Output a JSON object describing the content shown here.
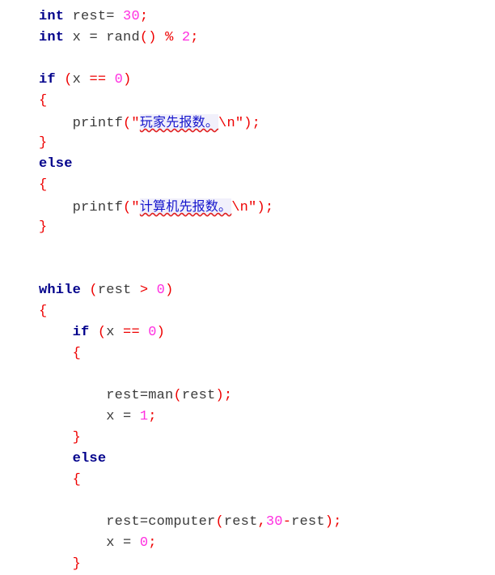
{
  "document": {
    "language": "C",
    "background_color": "#ffffff",
    "colors": {
      "keyword": "#00008b",
      "identifier": "#3b3b3b",
      "punctuation": "#ee0000",
      "number": "#ff2fe0",
      "string_cjk": "#1414cc",
      "string_highlight": "#f1f0fb",
      "spellcheck_underline": "#e02020"
    }
  },
  "code": {
    "lines": [
      {
        "id": "line-1",
        "indent": "",
        "tokens": [
          {
            "t": "keyword",
            "v": "int"
          },
          {
            "t": "plain",
            "v": " "
          },
          {
            "t": "ident",
            "v": "rest="
          },
          {
            "t": "plain",
            "v": " "
          },
          {
            "t": "number",
            "v": "30"
          },
          {
            "t": "punct",
            "v": ";"
          }
        ]
      },
      {
        "id": "line-2",
        "indent": "",
        "tokens": [
          {
            "t": "keyword",
            "v": "int"
          },
          {
            "t": "plain",
            "v": " "
          },
          {
            "t": "ident",
            "v": "x"
          },
          {
            "t": "plain",
            "v": " "
          },
          {
            "t": "ident",
            "v": "="
          },
          {
            "t": "plain",
            "v": " "
          },
          {
            "t": "ident",
            "v": "rand"
          },
          {
            "t": "punct",
            "v": "()"
          },
          {
            "t": "plain",
            "v": " "
          },
          {
            "t": "punct",
            "v": "%"
          },
          {
            "t": "plain",
            "v": " "
          },
          {
            "t": "number",
            "v": "2"
          },
          {
            "t": "punct",
            "v": ";"
          }
        ]
      },
      {
        "id": "line-3",
        "indent": "",
        "tokens": []
      },
      {
        "id": "line-4",
        "indent": "",
        "tokens": [
          {
            "t": "keyword",
            "v": "if"
          },
          {
            "t": "plain",
            "v": " "
          },
          {
            "t": "punct",
            "v": "("
          },
          {
            "t": "ident",
            "v": "x"
          },
          {
            "t": "plain",
            "v": " "
          },
          {
            "t": "punct",
            "v": "=="
          },
          {
            "t": "plain",
            "v": " "
          },
          {
            "t": "number",
            "v": "0"
          },
          {
            "t": "punct",
            "v": ")"
          }
        ]
      },
      {
        "id": "line-5",
        "indent": "",
        "tokens": [
          {
            "t": "punct",
            "v": "{"
          }
        ]
      },
      {
        "id": "line-6",
        "indent": "    ",
        "tokens": [
          {
            "t": "ident",
            "v": "printf"
          },
          {
            "t": "punct",
            "v": "(\""
          },
          {
            "t": "cjk",
            "v": "玩家先报数。"
          },
          {
            "t": "esc",
            "v": "\\n\")"
          },
          {
            "t": "punct",
            "v": ";"
          }
        ]
      },
      {
        "id": "line-7",
        "indent": "",
        "tokens": [
          {
            "t": "punct",
            "v": "}"
          }
        ]
      },
      {
        "id": "line-8",
        "indent": "",
        "tokens": [
          {
            "t": "keyword",
            "v": "else"
          }
        ]
      },
      {
        "id": "line-9",
        "indent": "",
        "tokens": [
          {
            "t": "punct",
            "v": "{"
          }
        ]
      },
      {
        "id": "line-10",
        "indent": "    ",
        "tokens": [
          {
            "t": "ident",
            "v": "printf"
          },
          {
            "t": "punct",
            "v": "(\""
          },
          {
            "t": "cjk",
            "v": "计算机先报数。"
          },
          {
            "t": "esc",
            "v": "\\n\")"
          },
          {
            "t": "punct",
            "v": ";"
          }
        ]
      },
      {
        "id": "line-11",
        "indent": "",
        "tokens": [
          {
            "t": "punct",
            "v": "}"
          }
        ]
      },
      {
        "id": "line-12",
        "indent": "",
        "tokens": []
      },
      {
        "id": "line-13",
        "indent": "",
        "tokens": []
      },
      {
        "id": "line-14",
        "indent": "",
        "tokens": [
          {
            "t": "keyword",
            "v": "while"
          },
          {
            "t": "plain",
            "v": " "
          },
          {
            "t": "punct",
            "v": "("
          },
          {
            "t": "ident",
            "v": "rest"
          },
          {
            "t": "plain",
            "v": " "
          },
          {
            "t": "punct",
            "v": ">"
          },
          {
            "t": "plain",
            "v": " "
          },
          {
            "t": "number",
            "v": "0"
          },
          {
            "t": "punct",
            "v": ")"
          }
        ]
      },
      {
        "id": "line-15",
        "indent": "",
        "tokens": [
          {
            "t": "punct",
            "v": "{"
          }
        ]
      },
      {
        "id": "line-16",
        "indent": "    ",
        "tokens": [
          {
            "t": "keyword",
            "v": "if"
          },
          {
            "t": "plain",
            "v": " "
          },
          {
            "t": "punct",
            "v": "("
          },
          {
            "t": "ident",
            "v": "x"
          },
          {
            "t": "plain",
            "v": " "
          },
          {
            "t": "punct",
            "v": "=="
          },
          {
            "t": "plain",
            "v": " "
          },
          {
            "t": "number",
            "v": "0"
          },
          {
            "t": "punct",
            "v": ")"
          }
        ]
      },
      {
        "id": "line-17",
        "indent": "    ",
        "tokens": [
          {
            "t": "punct",
            "v": "{"
          }
        ]
      },
      {
        "id": "line-18",
        "indent": "",
        "tokens": []
      },
      {
        "id": "line-19",
        "indent": "        ",
        "tokens": [
          {
            "t": "ident",
            "v": "rest=man"
          },
          {
            "t": "punct",
            "v": "("
          },
          {
            "t": "ident",
            "v": "rest"
          },
          {
            "t": "punct",
            "v": ");"
          }
        ]
      },
      {
        "id": "line-20",
        "indent": "        ",
        "tokens": [
          {
            "t": "ident",
            "v": "x"
          },
          {
            "t": "plain",
            "v": " "
          },
          {
            "t": "ident",
            "v": "="
          },
          {
            "t": "plain",
            "v": " "
          },
          {
            "t": "number",
            "v": "1"
          },
          {
            "t": "punct",
            "v": ";"
          }
        ]
      },
      {
        "id": "line-21",
        "indent": "    ",
        "tokens": [
          {
            "t": "punct",
            "v": "}"
          }
        ]
      },
      {
        "id": "line-22",
        "indent": "    ",
        "tokens": [
          {
            "t": "keyword",
            "v": "else"
          }
        ]
      },
      {
        "id": "line-23",
        "indent": "    ",
        "tokens": [
          {
            "t": "punct",
            "v": "{"
          }
        ]
      },
      {
        "id": "line-24",
        "indent": "",
        "tokens": []
      },
      {
        "id": "line-25",
        "indent": "        ",
        "tokens": [
          {
            "t": "ident",
            "v": "rest=computer"
          },
          {
            "t": "punct",
            "v": "("
          },
          {
            "t": "ident",
            "v": "rest"
          },
          {
            "t": "punct",
            "v": ","
          },
          {
            "t": "number",
            "v": "30"
          },
          {
            "t": "punct",
            "v": "-"
          },
          {
            "t": "ident",
            "v": "rest"
          },
          {
            "t": "punct",
            "v": ");"
          }
        ]
      },
      {
        "id": "line-26",
        "indent": "        ",
        "tokens": [
          {
            "t": "ident",
            "v": "x"
          },
          {
            "t": "plain",
            "v": " "
          },
          {
            "t": "ident",
            "v": "="
          },
          {
            "t": "plain",
            "v": " "
          },
          {
            "t": "number",
            "v": "0"
          },
          {
            "t": "punct",
            "v": ";"
          }
        ]
      },
      {
        "id": "line-27",
        "indent": "    ",
        "tokens": [
          {
            "t": "punct",
            "v": "}"
          }
        ]
      }
    ]
  }
}
